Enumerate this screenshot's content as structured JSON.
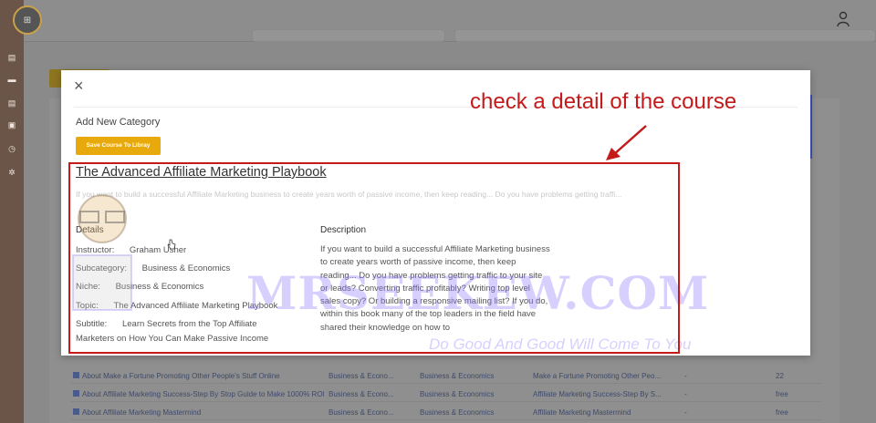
{
  "modal": {
    "close_label": "×",
    "heading": "Add New Category",
    "save_button": "Save Course To Libray",
    "course_title": "The Advanced Affiliate Marketing Playbook",
    "blurb": "If you want to build a successful Affiliate Marketing business to create years worth of passive income, then keep reading... Do you have problems getting traffi...",
    "details_heading": "Details",
    "description_heading": "Description",
    "details": [
      {
        "label": "Instructor:",
        "value": "Graham Usher"
      },
      {
        "label": "Subcategory:",
        "value": "Business & Economics"
      },
      {
        "label": "Niche:",
        "value": "Business & Economics"
      },
      {
        "label": "Topic:",
        "value": "The Advanced Affiliate Marketing Playbook"
      },
      {
        "label": "Subtitle:",
        "value": "Learn Secrets from the Top Affiliate"
      }
    ],
    "subtitle_cont": "Marketers on How You Can Make Passive Income",
    "description": "If you want to build a successful Affiliate Marketing business to create years worth of passive income, then keep reading... Do you have problems getting traffic to your site or leads? Converting traffic profitably? Writing top level sales copy? Or building a responsive mailing list? If you do, within this book many of the top leaders in the field have shared their knowledge on how to"
  },
  "annotation": {
    "text": "check a detail of the course",
    "color": "#c41a1a"
  },
  "watermark": {
    "main": "MRSEEKEW.COM",
    "sub": "Do Good And Good Will Come To You"
  },
  "background_table": {
    "rows": [
      {
        "title": "About Make a Fortune Promoting Other People's Stuff Online",
        "sub": "Business & Econo...",
        "niche": "Business & Economics",
        "topic": "Make a Fortune Promoting Other Peo...",
        "dash": "-",
        "price": "22"
      },
      {
        "title": "About Affiliate Marketing Success-Step By Stop Guide to Make 1000% ROI",
        "sub": "Business & Econo...",
        "niche": "Business & Economics",
        "topic": "Affiliate Marketing Success-Step By S...",
        "dash": "-",
        "price": "free"
      },
      {
        "title": "About Affiliate Marketing Mastermind",
        "sub": "Business & Econo...",
        "niche": "Business & Economics",
        "topic": "Affiliate Marketing Mastermind",
        "dash": "-",
        "price": "free"
      }
    ]
  },
  "colors": {
    "accent": "#e8a90d",
    "sidebar": "#6b5548",
    "annotation": "#c41a1a"
  }
}
